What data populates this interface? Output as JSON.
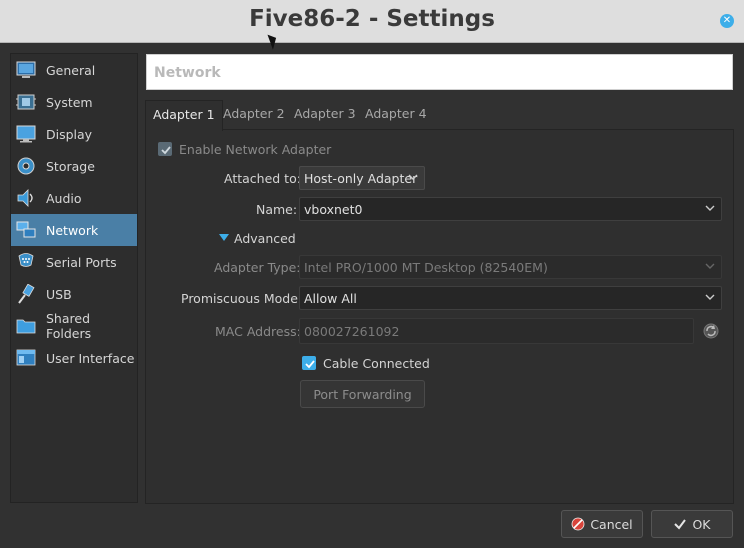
{
  "window": {
    "title": "Five86-2 - Settings"
  },
  "sidebar": {
    "items": [
      {
        "label": "General",
        "icon": "general-icon"
      },
      {
        "label": "System",
        "icon": "system-icon"
      },
      {
        "label": "Display",
        "icon": "display-icon"
      },
      {
        "label": "Storage",
        "icon": "storage-icon"
      },
      {
        "label": "Audio",
        "icon": "audio-icon"
      },
      {
        "label": "Network",
        "icon": "network-icon",
        "selected": true
      },
      {
        "label": "Serial Ports",
        "icon": "serial-ports-icon"
      },
      {
        "label": "USB",
        "icon": "usb-icon"
      },
      {
        "label": "Shared Folders",
        "icon": "shared-folders-icon"
      },
      {
        "label": "User Interface",
        "icon": "user-interface-icon"
      }
    ]
  },
  "page": {
    "header": "Network"
  },
  "tabs": [
    {
      "label": "Adapter 1",
      "active": true
    },
    {
      "label": "Adapter 2"
    },
    {
      "label": "Adapter 3"
    },
    {
      "label": "Adapter 4"
    }
  ],
  "adapter": {
    "enable_label": "Enable Network Adapter",
    "attached_label": "Attached to:",
    "attached_value": "Host-only Adapter",
    "name_label": "Name:",
    "name_value": "vboxnet0",
    "advanced_label": "Advanced",
    "adapter_type_label": "Adapter Type:",
    "adapter_type_value": "Intel PRO/1000 MT Desktop (82540EM)",
    "promiscuous_label": "Promiscuous Mode:",
    "promiscuous_value": "Allow All",
    "mac_label": "MAC Address:",
    "mac_value": "080027261092",
    "cable_label": "Cable Connected",
    "port_forwarding_label": "Port Forwarding"
  },
  "footer": {
    "cancel_label": "Cancel",
    "ok_label": "OK"
  },
  "colors": {
    "accent": "#3daee9",
    "selected": "#4a7fa6",
    "background": "#313131"
  }
}
